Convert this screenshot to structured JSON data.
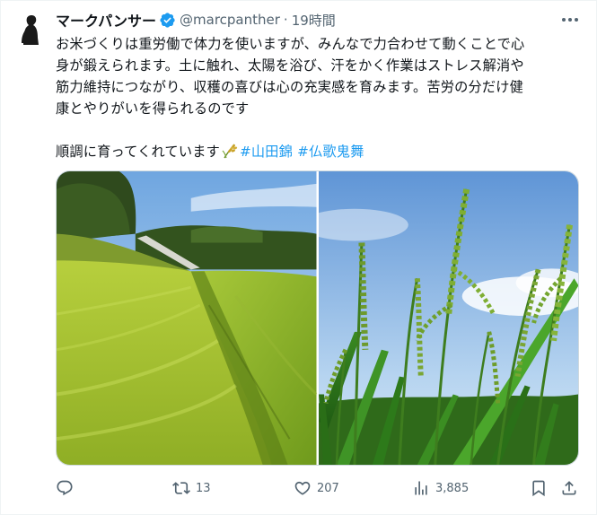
{
  "author": {
    "display_name": "マークパンサー",
    "handle": "@marcpanther",
    "separator": "·",
    "time": "19時間"
  },
  "tweet": {
    "lines": [
      "お米づくりは重労働で体力を使いますが、みんなで力合わせて動くことで心",
      "身が鍛えられます。土に触れ、太陽を浴び、汗をかく作業はストレス解消や",
      "筋力維持につながり、収穫の喜びは心の充実感を育みます。苦労の分だけ健",
      "康とやりがいを得られるのです"
    ],
    "line2_text": "順調に育ってくれています",
    "emoji": "rice-plant-icon",
    "hashtags": [
      "#山田錦",
      "#仏歌鬼舞"
    ]
  },
  "media": {
    "photos": [
      "rice-paddy-field",
      "rice-ears-closeup"
    ]
  },
  "actions": {
    "reply_count": "",
    "retweet_count": "13",
    "like_count": "207",
    "views_count": "3,885"
  },
  "colors": {
    "link": "#1d9bf0",
    "muted": "#536471",
    "verified": "#1d9bf0"
  }
}
